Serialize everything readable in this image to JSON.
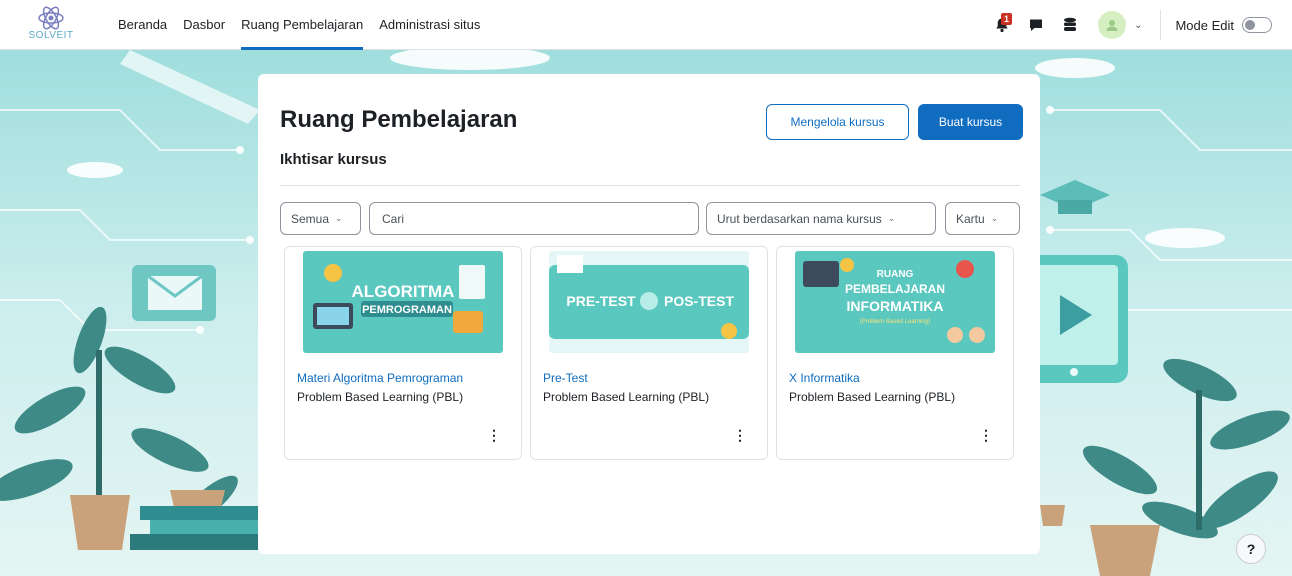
{
  "brand": {
    "name": "SOLVEIT"
  },
  "nav": {
    "links": [
      "Beranda",
      "Dasbor",
      "Ruang Pembelajaran",
      "Administrasi situs"
    ],
    "active_index": 2,
    "notification_count": "1",
    "mode_edit_label": "Mode Edit",
    "mode_edit_on": false
  },
  "page": {
    "title": "Ruang Pembelajaran",
    "manage_courses_label": "Mengelola kursus",
    "create_course_label": "Buat kursus",
    "overview_title": "Ikhtisar kursus"
  },
  "filters": {
    "grouping": "Semua",
    "search_placeholder": "Cari",
    "sort": "Urut berdasarkan nama kursus",
    "view": "Kartu"
  },
  "courses": [
    {
      "name": "Materi Algoritma Pemrograman",
      "category": "Problem Based Learning (PBL)",
      "image_text": [
        "ALGORITMA",
        "PEMROGRAMAN"
      ]
    },
    {
      "name": "Pre-Test",
      "category": "Problem Based Learning (PBL)",
      "image_text": [
        "PRE-TEST",
        "POS-TEST"
      ]
    },
    {
      "name": "X Informatika",
      "category": "Problem Based Learning (PBL)",
      "image_text": [
        "RUANG",
        "PEMBELAJARAN",
        "INFORMATIKA",
        "(Problem Based Learning)"
      ]
    }
  ],
  "help": {
    "label": "?"
  },
  "colors": {
    "primary": "#0f6cbf",
    "card_image_bg": "#5bc8c0",
    "background": "#cfeeee"
  }
}
